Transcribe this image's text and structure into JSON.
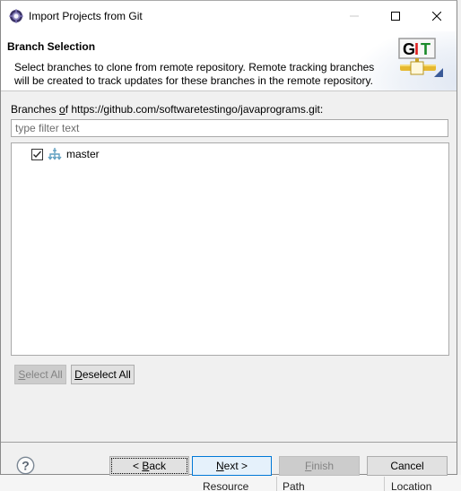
{
  "window": {
    "title": "Import Projects from Git",
    "app_icon": "eclipse-gear-icon",
    "controls": [
      "minimize-icon",
      "maximize-icon",
      "close-icon"
    ]
  },
  "header": {
    "title": "Branch Selection",
    "description": "Select branches to clone from remote repository. Remote tracking branches will be created to track updates for these branches in the remote repository.",
    "logo_text": "GIT",
    "logo_icon": "git-wizard-icon"
  },
  "branches": {
    "label_prefix": "Branches ",
    "label_mnemonic": "o",
    "label_rest": "f https://github.com/softwaretestingo/javaprograms.git:",
    "filter": {
      "value": "",
      "placeholder": "type filter text"
    },
    "items": [
      {
        "label": "master",
        "checked": true,
        "icon": "branch-icon"
      }
    ]
  },
  "selection_buttons": {
    "select_all": {
      "mnemonic": "S",
      "rest": "elect All",
      "enabled": false
    },
    "deselect_all": {
      "mnemonic": "D",
      "rest": "eselect All",
      "enabled": true
    }
  },
  "footer": {
    "help_icon": "help-icon",
    "back": {
      "prefix": "< ",
      "mnemonic": "B",
      "rest": "ack",
      "enabled": true
    },
    "next": {
      "mnemonic": "N",
      "rest": "ext >",
      "enabled": true
    },
    "finish": {
      "mnemonic": "F",
      "rest": "inish",
      "enabled": false
    },
    "cancel": {
      "label": "Cancel",
      "enabled": true
    }
  },
  "background_columns": [
    "Resource",
    "Path",
    "Location"
  ],
  "colors": {
    "accent_blue": "#0078d7",
    "git_g": "#000000",
    "git_i": "#e02020",
    "git_t": "#1a8a2a"
  }
}
